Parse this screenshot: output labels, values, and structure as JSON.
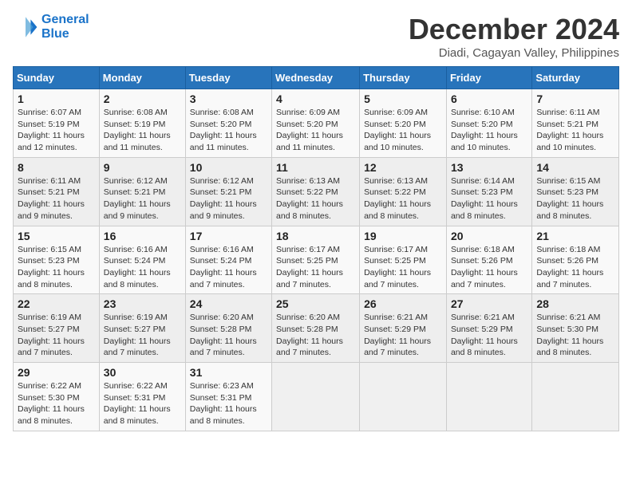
{
  "logo": {
    "line1": "General",
    "line2": "Blue"
  },
  "title": "December 2024",
  "subtitle": "Diadi, Cagayan Valley, Philippines",
  "days_of_week": [
    "Sunday",
    "Monday",
    "Tuesday",
    "Wednesday",
    "Thursday",
    "Friday",
    "Saturday"
  ],
  "weeks": [
    [
      {
        "day": "1",
        "sunrise": "6:07 AM",
        "sunset": "5:19 PM",
        "daylight": "11 hours and 12 minutes."
      },
      {
        "day": "2",
        "sunrise": "6:08 AM",
        "sunset": "5:19 PM",
        "daylight": "11 hours and 11 minutes."
      },
      {
        "day": "3",
        "sunrise": "6:08 AM",
        "sunset": "5:20 PM",
        "daylight": "11 hours and 11 minutes."
      },
      {
        "day": "4",
        "sunrise": "6:09 AM",
        "sunset": "5:20 PM",
        "daylight": "11 hours and 11 minutes."
      },
      {
        "day": "5",
        "sunrise": "6:09 AM",
        "sunset": "5:20 PM",
        "daylight": "11 hours and 10 minutes."
      },
      {
        "day": "6",
        "sunrise": "6:10 AM",
        "sunset": "5:20 PM",
        "daylight": "11 hours and 10 minutes."
      },
      {
        "day": "7",
        "sunrise": "6:11 AM",
        "sunset": "5:21 PM",
        "daylight": "11 hours and 10 minutes."
      }
    ],
    [
      {
        "day": "8",
        "sunrise": "6:11 AM",
        "sunset": "5:21 PM",
        "daylight": "11 hours and 9 minutes."
      },
      {
        "day": "9",
        "sunrise": "6:12 AM",
        "sunset": "5:21 PM",
        "daylight": "11 hours and 9 minutes."
      },
      {
        "day": "10",
        "sunrise": "6:12 AM",
        "sunset": "5:21 PM",
        "daylight": "11 hours and 9 minutes."
      },
      {
        "day": "11",
        "sunrise": "6:13 AM",
        "sunset": "5:22 PM",
        "daylight": "11 hours and 8 minutes."
      },
      {
        "day": "12",
        "sunrise": "6:13 AM",
        "sunset": "5:22 PM",
        "daylight": "11 hours and 8 minutes."
      },
      {
        "day": "13",
        "sunrise": "6:14 AM",
        "sunset": "5:23 PM",
        "daylight": "11 hours and 8 minutes."
      },
      {
        "day": "14",
        "sunrise": "6:15 AM",
        "sunset": "5:23 PM",
        "daylight": "11 hours and 8 minutes."
      }
    ],
    [
      {
        "day": "15",
        "sunrise": "6:15 AM",
        "sunset": "5:23 PM",
        "daylight": "11 hours and 8 minutes."
      },
      {
        "day": "16",
        "sunrise": "6:16 AM",
        "sunset": "5:24 PM",
        "daylight": "11 hours and 8 minutes."
      },
      {
        "day": "17",
        "sunrise": "6:16 AM",
        "sunset": "5:24 PM",
        "daylight": "11 hours and 7 minutes."
      },
      {
        "day": "18",
        "sunrise": "6:17 AM",
        "sunset": "5:25 PM",
        "daylight": "11 hours and 7 minutes."
      },
      {
        "day": "19",
        "sunrise": "6:17 AM",
        "sunset": "5:25 PM",
        "daylight": "11 hours and 7 minutes."
      },
      {
        "day": "20",
        "sunrise": "6:18 AM",
        "sunset": "5:26 PM",
        "daylight": "11 hours and 7 minutes."
      },
      {
        "day": "21",
        "sunrise": "6:18 AM",
        "sunset": "5:26 PM",
        "daylight": "11 hours and 7 minutes."
      }
    ],
    [
      {
        "day": "22",
        "sunrise": "6:19 AM",
        "sunset": "5:27 PM",
        "daylight": "11 hours and 7 minutes."
      },
      {
        "day": "23",
        "sunrise": "6:19 AM",
        "sunset": "5:27 PM",
        "daylight": "11 hours and 7 minutes."
      },
      {
        "day": "24",
        "sunrise": "6:20 AM",
        "sunset": "5:28 PM",
        "daylight": "11 hours and 7 minutes."
      },
      {
        "day": "25",
        "sunrise": "6:20 AM",
        "sunset": "5:28 PM",
        "daylight": "11 hours and 7 minutes."
      },
      {
        "day": "26",
        "sunrise": "6:21 AM",
        "sunset": "5:29 PM",
        "daylight": "11 hours and 7 minutes."
      },
      {
        "day": "27",
        "sunrise": "6:21 AM",
        "sunset": "5:29 PM",
        "daylight": "11 hours and 8 minutes."
      },
      {
        "day": "28",
        "sunrise": "6:21 AM",
        "sunset": "5:30 PM",
        "daylight": "11 hours and 8 minutes."
      }
    ],
    [
      {
        "day": "29",
        "sunrise": "6:22 AM",
        "sunset": "5:30 PM",
        "daylight": "11 hours and 8 minutes."
      },
      {
        "day": "30",
        "sunrise": "6:22 AM",
        "sunset": "5:31 PM",
        "daylight": "11 hours and 8 minutes."
      },
      {
        "day": "31",
        "sunrise": "6:23 AM",
        "sunset": "5:31 PM",
        "daylight": "11 hours and 8 minutes."
      },
      null,
      null,
      null,
      null
    ]
  ],
  "labels": {
    "sunrise_prefix": "Sunrise: ",
    "sunset_prefix": "Sunset: ",
    "daylight_prefix": "Daylight: "
  }
}
